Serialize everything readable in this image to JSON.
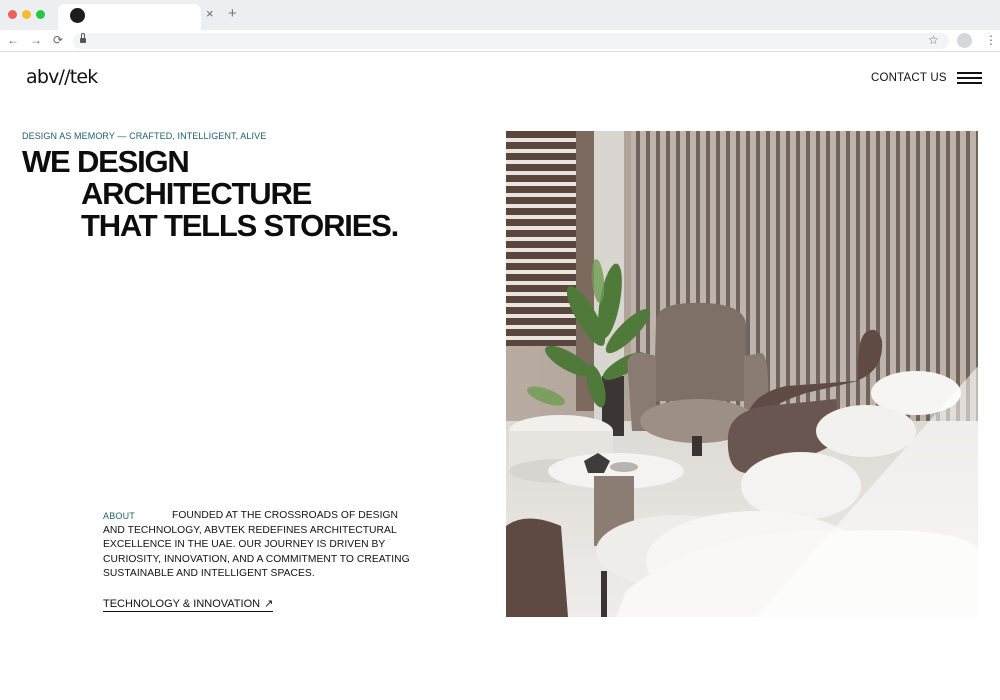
{
  "browser": {
    "tab_close_glyph": "×",
    "new_tab_glyph": "+",
    "back_glyph": "←",
    "forward_glyph": "→",
    "reload_glyph": "⟳",
    "bookmark_glyph": "☆",
    "menu_glyph": "⋮"
  },
  "header": {
    "logo": "abv//tek",
    "contact_label": "CONTACT US",
    "menu_icon": "hamburger-icon"
  },
  "hero": {
    "tagline": "DESIGN AS MEMORY — CRAFTED, INTELLIGENT, ALIVE",
    "headline_lines": [
      "WE DESIGN",
      "ARCHITECTURE",
      "THAT TELLS STORIES."
    ]
  },
  "about": {
    "label": "ABOUT",
    "text": "FOUNDED AT THE CROSSROADS OF DESIGN AND TECHNOLOGY, ABVTEK REDEFINES ARCHITECTURAL EXCELLENCE IN THE UAE. OUR JOURNEY IS DRIVEN BY CURIOSITY, INNOVATION, AND A COMMITMENT TO CREATING SUSTAINABLE AND INTELLIGENT SPACES.",
    "link_label": "TECHNOLOGY & INNOVATION",
    "link_icon": "↗"
  },
  "colors": {
    "accent": "#1f5e6a",
    "text": "#111111",
    "background": "#ffffff"
  }
}
